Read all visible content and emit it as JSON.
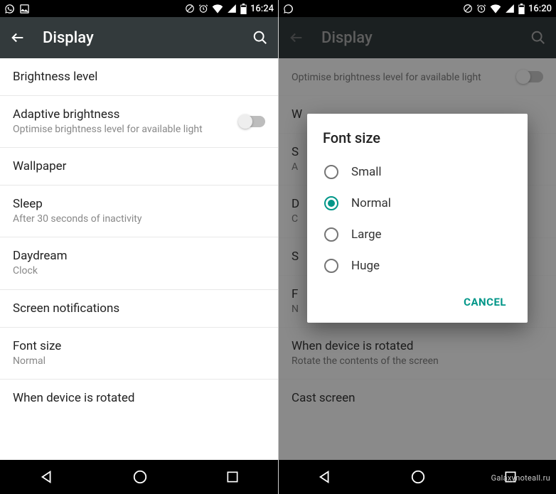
{
  "left": {
    "status_time": "16:24",
    "toolbar_title": "Display",
    "rows": {
      "brightness": {
        "primary": "Brightness level"
      },
      "adaptive": {
        "primary": "Adaptive brightness",
        "secondary": "Optimise brightness level for available light"
      },
      "wallpaper": {
        "primary": "Wallpaper"
      },
      "sleep": {
        "primary": "Sleep",
        "secondary": "After 30 seconds of inactivity"
      },
      "daydream": {
        "primary": "Daydream",
        "secondary": "Clock"
      },
      "screennot": {
        "primary": "Screen notifications"
      },
      "fontsize": {
        "primary": "Font size",
        "secondary": "Normal"
      },
      "rotated": {
        "primary": "When device is rotated"
      }
    }
  },
  "right": {
    "status_time": "16:20",
    "toolbar_title": "Display",
    "bg_rows": {
      "adaptive": {
        "secondary": "Optimise brightness level for available light"
      },
      "w": {
        "primary": "W"
      },
      "s": {
        "primary": "S",
        "secondary": "A"
      },
      "d": {
        "primary": "D",
        "secondary": "C"
      },
      "s2": {
        "primary": "S"
      },
      "f": {
        "primary": "F",
        "secondary": "N"
      },
      "rotated": {
        "primary": "When device is rotated",
        "secondary": "Rotate the contents of the screen"
      },
      "cast": {
        "primary": "Cast screen"
      }
    },
    "dialog": {
      "title": "Font size",
      "options": [
        "Small",
        "Normal",
        "Large",
        "Huge"
      ],
      "selected_index": 1,
      "cancel": "CANCEL"
    }
  },
  "watermark": "Galaxynoteall.ru"
}
